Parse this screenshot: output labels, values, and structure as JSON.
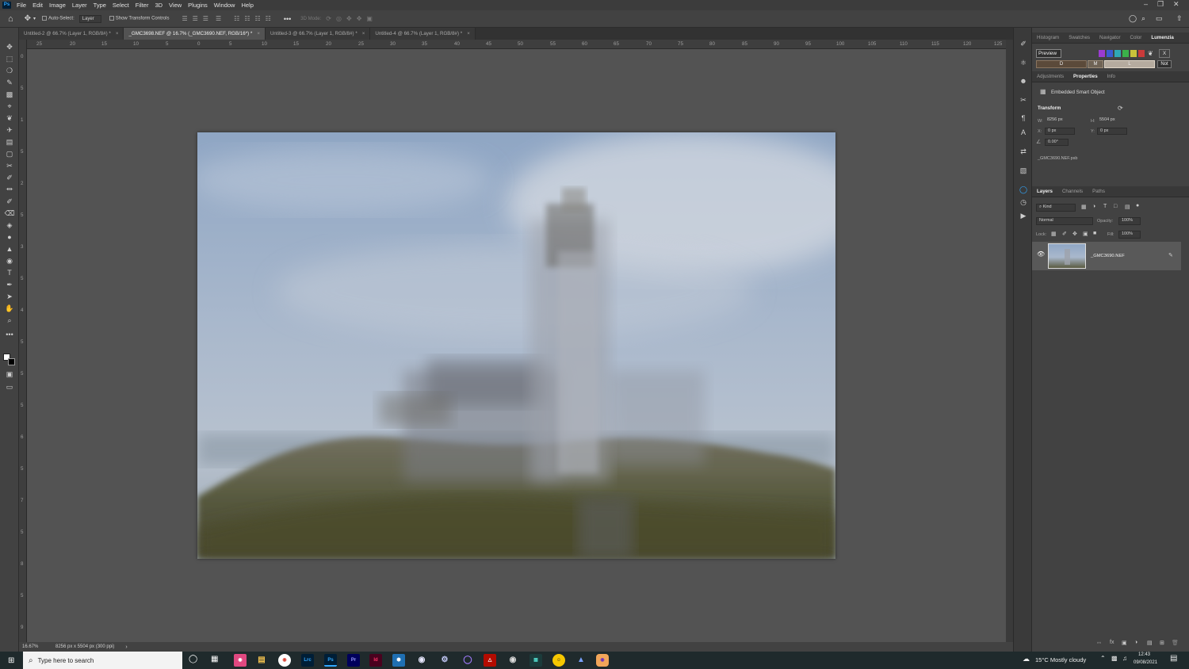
{
  "menu": [
    "File",
    "Edit",
    "Image",
    "Layer",
    "Type",
    "Select",
    "Filter",
    "3D",
    "View",
    "Plugins",
    "Window",
    "Help"
  ],
  "app_logo": "Ps",
  "options_bar": {
    "auto_select_label": "Auto-Select:",
    "auto_select_value": "Layer",
    "show_transform_label": "Show Transform Controls",
    "mode_3d_label": "3D Mode:"
  },
  "doc_tabs": [
    {
      "label": "Untitled-2 @ 66.7% (Layer 1, RGB/8#) *",
      "active": false
    },
    {
      "label": "_GMC3698.NEF @ 16.7% (_GMC3690.NEF, RGB/16*) *",
      "active": true
    },
    {
      "label": "Untitled-3 @ 66.7% (Layer 1, RGB/8#) *",
      "active": false
    },
    {
      "label": "Untitled-4 @ 66.7% (Layer 1, RGB/8#) *",
      "active": false
    }
  ],
  "ruler_h_labels": [
    "25",
    "20",
    "15",
    "10",
    "5",
    "0",
    "5",
    "10",
    "15",
    "20",
    "25",
    "30",
    "35",
    "40",
    "45",
    "50",
    "55",
    "60",
    "65",
    "70",
    "75",
    "80",
    "85",
    "90",
    "95",
    "100",
    "105",
    "110",
    "115",
    "120",
    "125"
  ],
  "ruler_v_labels": [
    "0",
    "5",
    "1",
    "5",
    "2",
    "5",
    "3",
    "5",
    "4",
    "5",
    "5",
    "5",
    "6",
    "5",
    "7",
    "5",
    "8",
    "5",
    "9",
    "5"
  ],
  "status": {
    "zoom": "16.67%",
    "doc_info": "8256 px x 5504 px (300 ppi)"
  },
  "panel_top_tabs": [
    "Histogram",
    "Swatches",
    "Navigator",
    "Color",
    "Lumenzia"
  ],
  "lumenzia": {
    "preview_label": "Preview",
    "buttons": [
      "D",
      "M",
      "L"
    ],
    "x_label": "X",
    "not_label": "Not"
  },
  "props_tabs": [
    "Adjustments",
    "Properties",
    "Info"
  ],
  "properties": {
    "type_label": "Embedded Smart Object",
    "transform_label": "Transform",
    "w_label": "W:",
    "w_value": "8256 px",
    "h_label": "H:",
    "h_value": "5504 px",
    "x_label": "X:",
    "x_value": "0 px",
    "y_label": "Y:",
    "y_value": "0 px",
    "angle_value": "0.00°",
    "file_name": "_GMC3690.NEF.psb"
  },
  "layers_tabs": [
    "Layers",
    "Channels",
    "Paths"
  ],
  "layers_panel": {
    "kind_label": "Kind",
    "blend_mode": "Normal",
    "opacity_label": "Opacity:",
    "opacity_value": "100%",
    "lock_label": "Lock:",
    "fill_label": "Fill:",
    "fill_value": "100%",
    "layers": [
      {
        "name": "_GMC3690.NEF",
        "visible": true
      }
    ]
  },
  "taskbar": {
    "search_placeholder": "Type here to search",
    "apps": [
      "Lrc",
      "Ps",
      "Pr",
      "Id"
    ],
    "weather": "15°C  Mostly cloudy",
    "time": "12:43",
    "date": "09/08/2021"
  },
  "colors": {
    "accent_blue": "#31a8ff",
    "panel_bg": "#424242",
    "canvas_bg": "#535353"
  }
}
